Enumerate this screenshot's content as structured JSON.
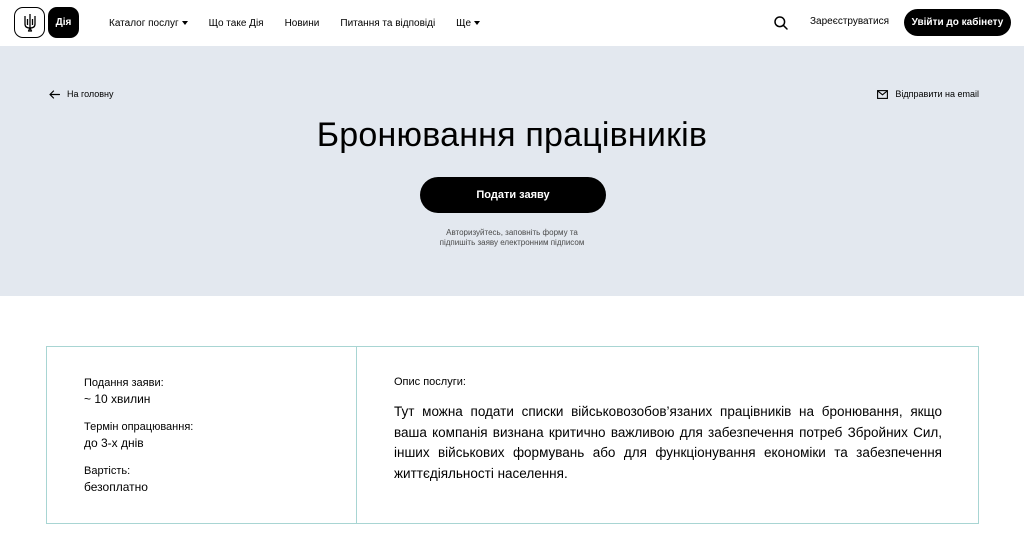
{
  "header": {
    "logo_text": "Дія",
    "nav": [
      {
        "label": "Каталог послуг",
        "has_caret": true
      },
      {
        "label": "Що таке Дія",
        "has_caret": false
      },
      {
        "label": "Новини",
        "has_caret": false
      },
      {
        "label": "Питання та відповіді",
        "has_caret": false
      },
      {
        "label": "Ще",
        "has_caret": true
      }
    ],
    "register_label": "Зареєструватися",
    "login_label": "Увійти до кабінету"
  },
  "hero": {
    "back_label": "На головну",
    "email_label": "Відправити на email",
    "title": "Бронювання працівників",
    "apply_label": "Подати заяву",
    "hint_line1": "Авторизуйтесь, заповніть форму та",
    "hint_line2": "підпишіть заяву електронним підписом"
  },
  "card": {
    "meta": [
      {
        "label": "Подання заяви:",
        "value": "~ 10 хвилин"
      },
      {
        "label": "Термін опрацювання:",
        "value": "до 3-х днів"
      },
      {
        "label": "Вартість:",
        "value": "безоплатно"
      }
    ],
    "description_label": "Опис послуги:",
    "description": "Тут можна подати списки військовозобов’язаних працівників на бронювання, якщо ваша компанія визнана критично важливою для забезпечення потреб Збройних Сил, інших військових формувань або для функціонування економіки та забезпечення життєдіяльності населення."
  },
  "colors": {
    "hero_bg": "#e3e8ef",
    "accent_border": "#a8d5d3",
    "button_bg": "#000000"
  }
}
